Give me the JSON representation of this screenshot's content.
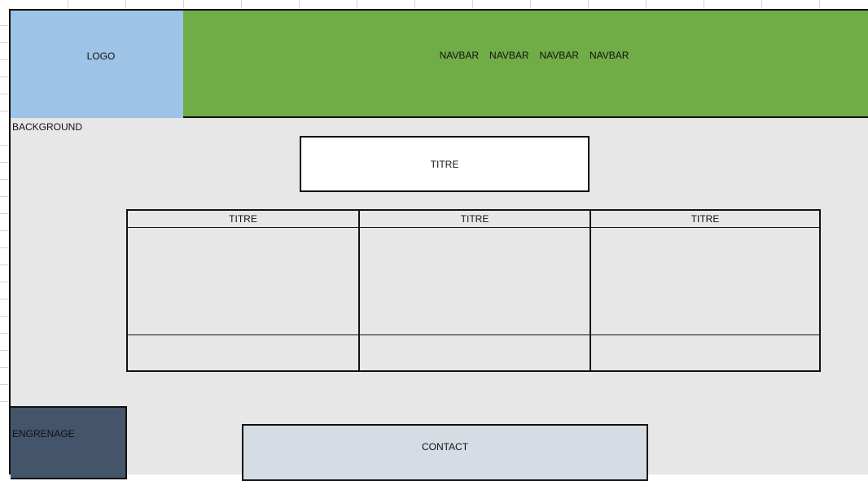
{
  "header": {
    "logo_label": "LOGO",
    "nav_items": [
      "NAVBAR",
      "NAVBAR",
      "NAVBAR",
      "NAVBAR"
    ]
  },
  "background_label": "BACKGROUND",
  "main_title": "TITRE",
  "columns": [
    {
      "title": "TITRE"
    },
    {
      "title": "TITRE"
    },
    {
      "title": "TITRE"
    }
  ],
  "gear_label": "ENGRENAGE",
  "contact_label": "CONTACT",
  "colors": {
    "logo": "#9dc3e6",
    "navbar": "#70ad47",
    "background": "#e7e7e7",
    "gear": "#44546a",
    "contact": "#d6dce4"
  }
}
